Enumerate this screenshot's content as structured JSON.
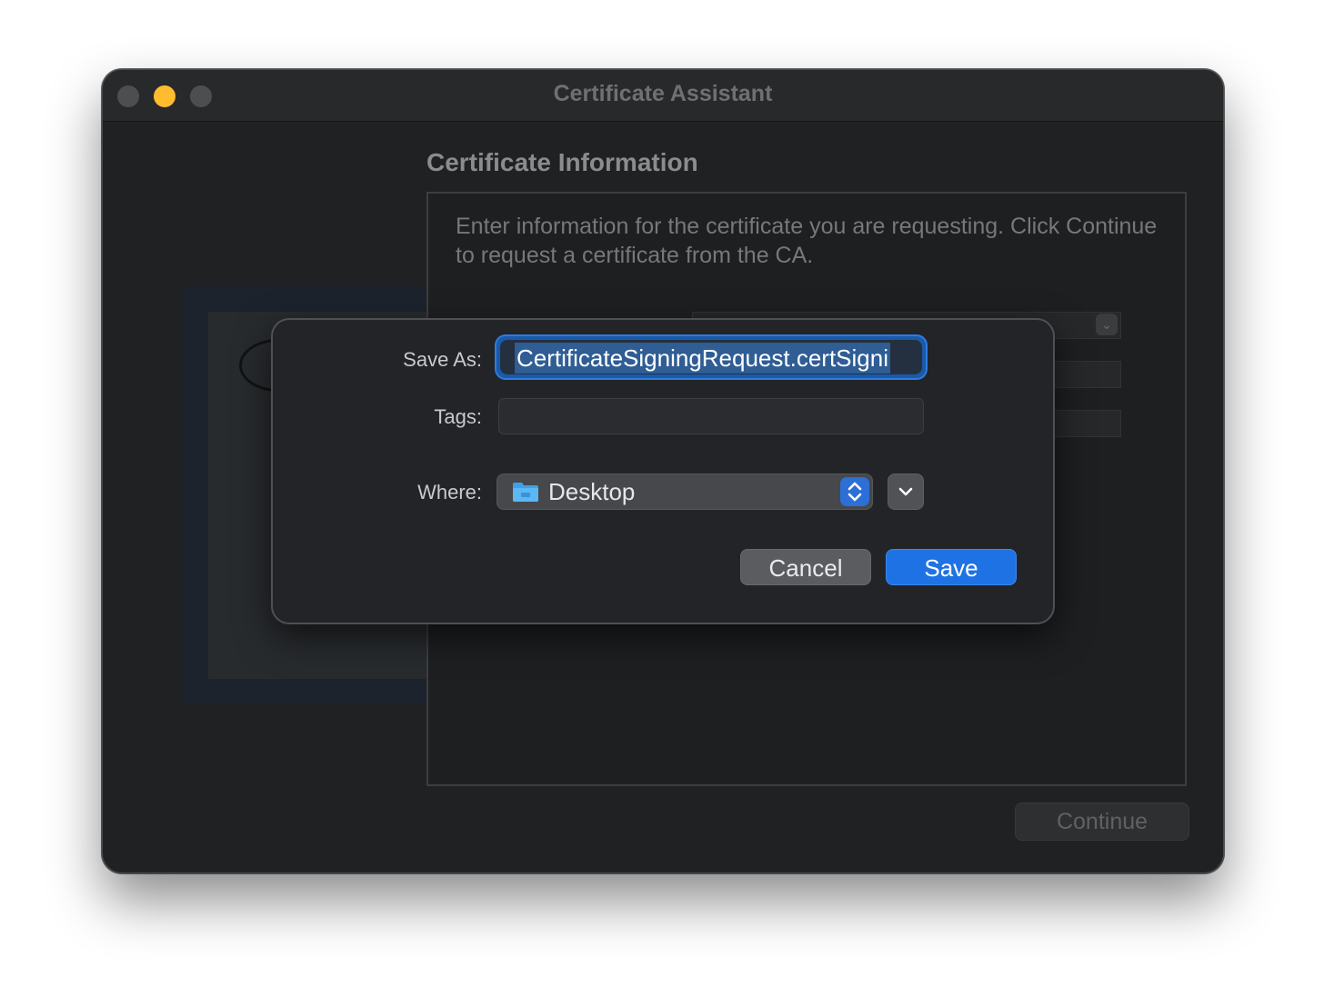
{
  "window": {
    "title": "Certificate Assistant"
  },
  "assistant": {
    "section_title": "Certificate Information",
    "info_text": "Enter information for the certificate you are requesting. Click Continue to request a certificate from the CA.",
    "continue_label": "Continue"
  },
  "save_sheet": {
    "save_as_label": "Save As:",
    "save_as_value": "CertificateSigningRequest.certSigni",
    "tags_label": "Tags:",
    "tags_value": "",
    "where_label": "Where:",
    "where_value": "Desktop",
    "cancel_label": "Cancel",
    "save_label": "Save"
  },
  "colors": {
    "accent": "#1f72e3",
    "minimize_button": "#febc2e"
  },
  "icons": [
    "folder-icon",
    "up-down-chevron-icon",
    "chevron-down-icon"
  ]
}
